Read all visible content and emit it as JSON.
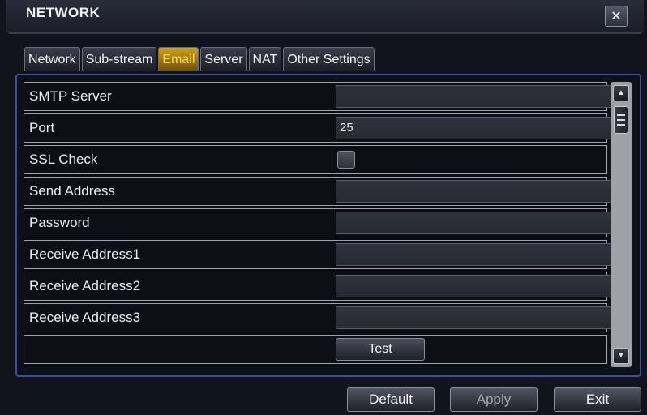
{
  "window": {
    "title": "NETWORK",
    "close_glyph": "✕"
  },
  "tabs": [
    {
      "label": "Network",
      "active": false
    },
    {
      "label": "Sub-stream",
      "active": false
    },
    {
      "label": "Email",
      "active": true
    },
    {
      "label": "Server",
      "active": false
    },
    {
      "label": "NAT",
      "active": false
    },
    {
      "label": "Other Settings",
      "active": false
    }
  ],
  "form": {
    "smtp_server": {
      "label": "SMTP Server",
      "value": ""
    },
    "port": {
      "label": "Port",
      "value": "25"
    },
    "ssl_check": {
      "label": "SSL Check",
      "checked": false
    },
    "send_address": {
      "label": "Send Address",
      "value": ""
    },
    "password": {
      "label": "Password",
      "value": ""
    },
    "receive_address1": {
      "label": "Receive Address1",
      "value": ""
    },
    "receive_address2": {
      "label": "Receive Address2",
      "value": ""
    },
    "receive_address3": {
      "label": "Receive Address3",
      "value": ""
    },
    "test_label": "Test"
  },
  "scrollbar": {
    "up_glyph": "▲",
    "down_glyph": "▼"
  },
  "footer": {
    "default_label": "Default",
    "apply_label": "Apply",
    "exit_label": "Exit"
  },
  "colors": {
    "active_tab": "#d0a01a",
    "panel_border": "#3d4f9a"
  }
}
